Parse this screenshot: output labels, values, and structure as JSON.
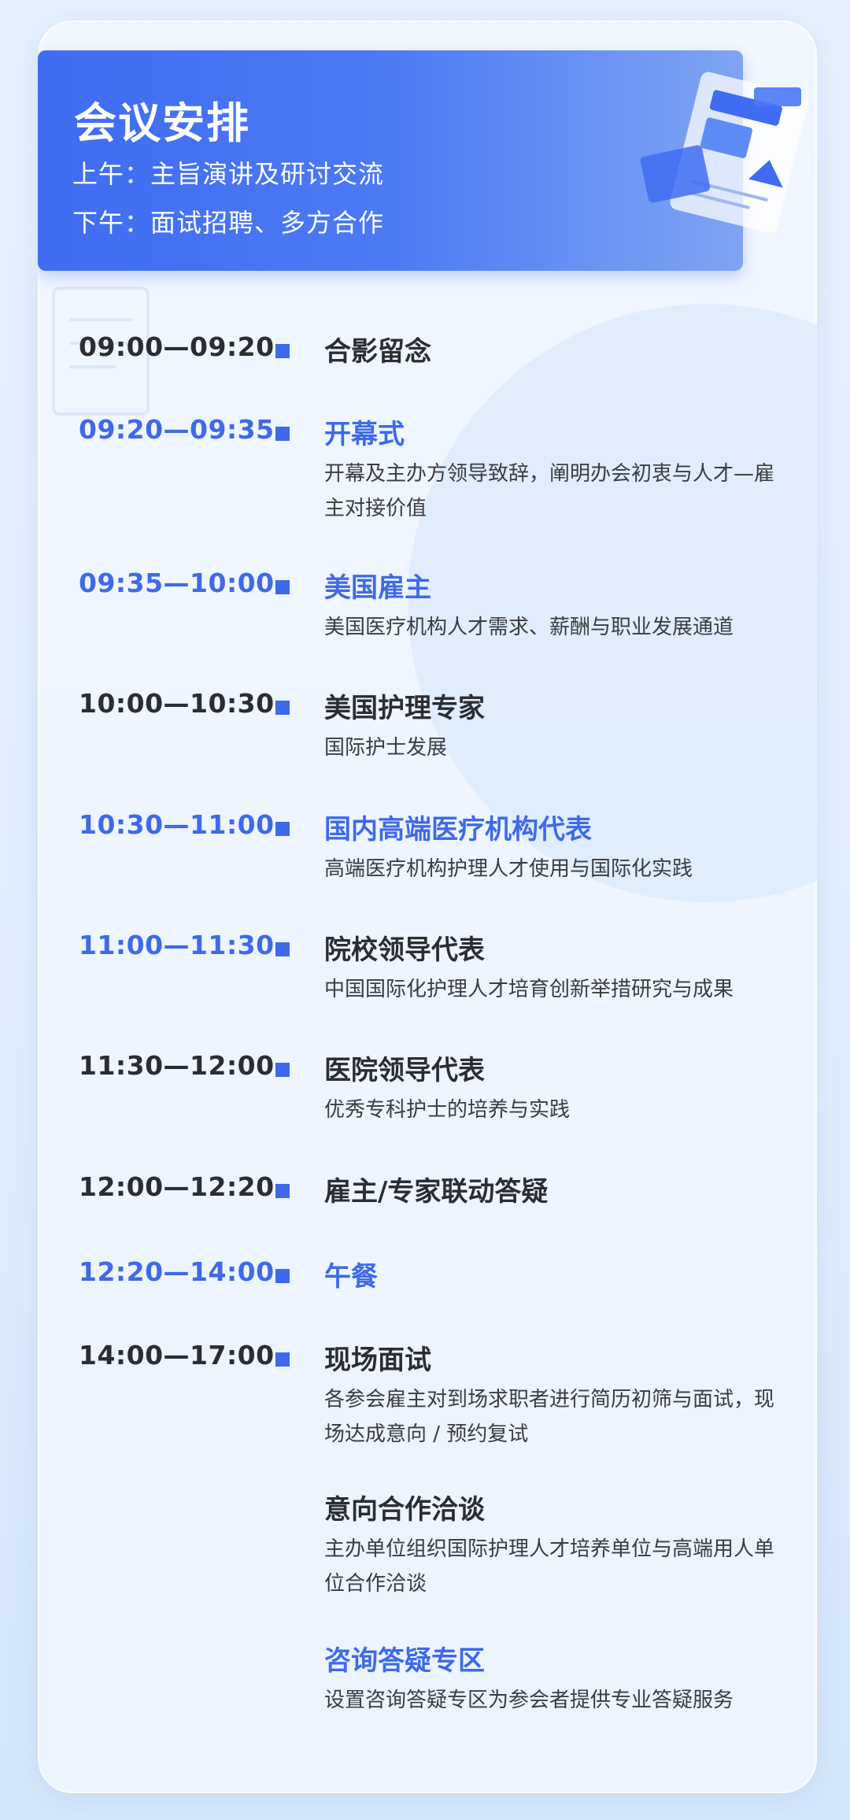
{
  "header": {
    "title": "会议安排",
    "morning": "上午：主旨演讲及研讨交流",
    "afternoon": "下午：面试招聘、多方合作"
  },
  "colors": {
    "accent": "#3e69ea",
    "text": "#2b2d33"
  },
  "schedule": [
    {
      "time": "09:00—09:20",
      "title": "合影留念",
      "desc": ""
    },
    {
      "time": "09:20—09:35",
      "title": "开幕式",
      "desc": "开幕及主办方领导致辞，阐明办会初衷与人才—雇主对接价值"
    },
    {
      "time": "09:35—10:00",
      "title": "美国雇主",
      "desc": "美国医疗机构人才需求、薪酬与职业发展通道"
    },
    {
      "time": "10:00—10:30",
      "title": "美国护理专家",
      "desc": "国际护士发展"
    },
    {
      "time": "10:30—11:00",
      "title": "国内高端医疗机构代表",
      "desc": "高端医疗机构护理人才使用与国际化实践"
    },
    {
      "time": "11:00—11:30",
      "title": "院校领导代表",
      "desc": "中国国际化护理人才培育创新举措研究与成果"
    },
    {
      "time": "11:30—12:00",
      "title": "医院领导代表",
      "desc": "优秀专科护士的培养与实践"
    },
    {
      "time": "12:00—12:20",
      "title": "雇主/专家联动答疑",
      "desc": ""
    },
    {
      "time": "12:20—14:00",
      "title": "午餐",
      "desc": ""
    },
    {
      "time": "14:00—17:00",
      "title": "现场面试",
      "desc": "各参会雇主对到场求职者进行简历初筛与面试，现场达成意向 / 预约复试"
    },
    {
      "time": "",
      "title": "意向合作洽谈",
      "desc": "主办单位组织国际护理人才培养单位与高端用人单位合作洽谈"
    },
    {
      "time": "",
      "title": "咨询答疑专区",
      "desc": "设置咨询答疑专区为参会者提供专业答疑服务"
    }
  ]
}
